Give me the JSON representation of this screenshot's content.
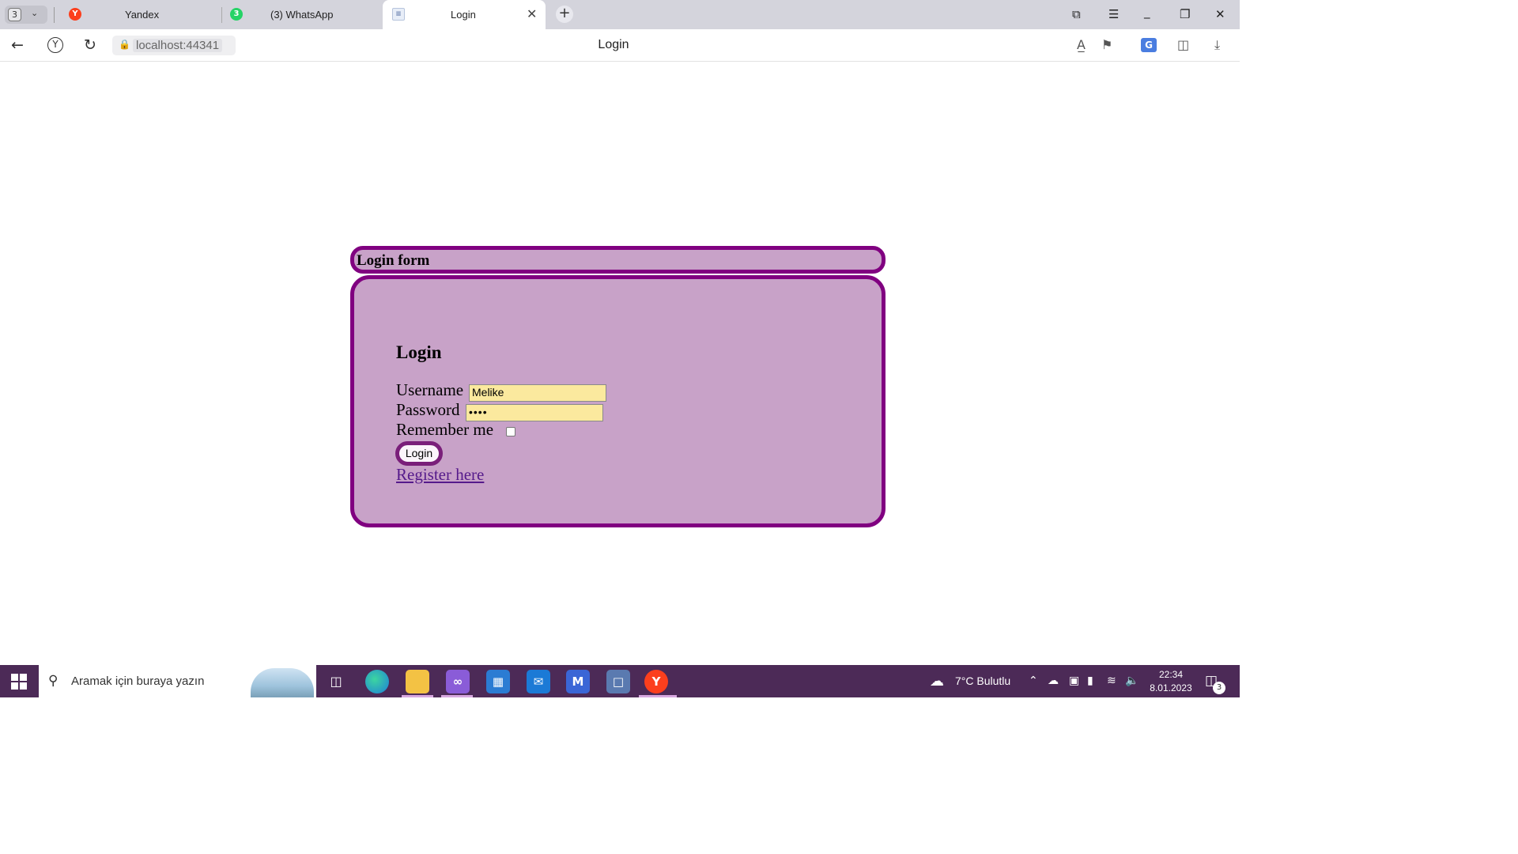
{
  "browser": {
    "tab_count": "3",
    "tabs": [
      {
        "label": "Yandex",
        "favicon": "Y"
      },
      {
        "label": "(3) WhatsApp",
        "favicon": "3"
      },
      {
        "label": "Login",
        "favicon": "page"
      }
    ],
    "url": "localhost:44341",
    "page_title": "Login"
  },
  "page": {
    "header_title": "Login form",
    "heading": "Login",
    "username_label": "Username",
    "username_value": "Melike",
    "password_label": "Password",
    "password_value": "••••",
    "remember_label": "Remember me",
    "remember_checked": false,
    "login_button": "Login",
    "register_link": "Register here",
    "colors": {
      "panel_bg": "#c8a2c8",
      "border": "#800080",
      "input_bg": "#fbe99e"
    }
  },
  "taskbar": {
    "search_placeholder": "Aramak için buraya yazın",
    "weather": "7°C  Bulutlu",
    "time": "22:34",
    "date": "8.01.2023",
    "notification_count": "3",
    "pinned_apps": [
      "task-view",
      "edge",
      "file-explorer",
      "visual-studio",
      "microsoft-store",
      "mail",
      "teams-or-app",
      "remote-desktop",
      "yandex-browser"
    ]
  }
}
